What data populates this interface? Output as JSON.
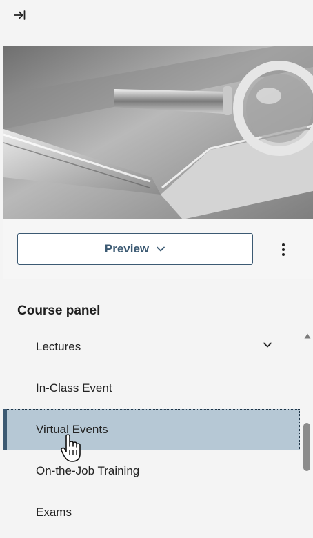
{
  "header": {
    "collapse_icon": "collapse-panel-icon"
  },
  "hero": {
    "icon": "magnifying-glass-on-book-image"
  },
  "actions": {
    "preview_label": "Preview",
    "dropdown_icon": "chevron-down-icon",
    "more_icon": "more-vertical-icon"
  },
  "panel": {
    "title": "Course panel",
    "items": [
      {
        "label": "Lectures",
        "expandable": true,
        "active": false
      },
      {
        "label": "In-Class Event",
        "expandable": false,
        "active": false
      },
      {
        "label": "Virtual Events",
        "expandable": false,
        "active": true
      },
      {
        "label": "On-the-Job Training",
        "expandable": false,
        "active": false
      },
      {
        "label": "Exams",
        "expandable": false,
        "active": false
      }
    ]
  },
  "colors": {
    "accent": "#3c5a73",
    "active_bg": "#b6c8d5",
    "page_bg": "#f4f4f4"
  }
}
